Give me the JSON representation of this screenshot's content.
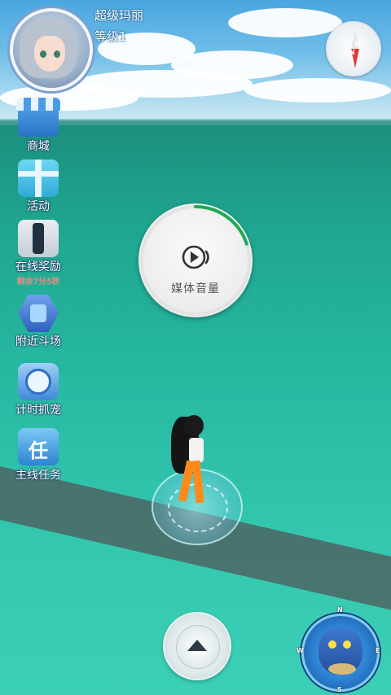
{
  "player": {
    "name": "超级玛丽",
    "level": "等级1"
  },
  "compass": {
    "north": "N",
    "south": "S"
  },
  "side_menu": {
    "items": [
      {
        "label": "商城",
        "icon": "shop-icon"
      },
      {
        "label": "活动",
        "icon": "gift-icon"
      },
      {
        "label": "在线奖励",
        "sublabel": "剩余7分5秒",
        "icon": "online-reward-icon"
      },
      {
        "label": "附近斗场",
        "icon": "arena-icon"
      },
      {
        "label": "计时抓宠",
        "icon": "timer-catch-icon"
      },
      {
        "label": "主线任务",
        "icon": "main-quest-icon",
        "glyph": "任"
      }
    ]
  },
  "media_volume": {
    "label": "媒体音量",
    "level": 0.2,
    "icon": "play-sound-icon",
    "accent": "#1faa54"
  },
  "controls": {
    "move_button_icon": "up-arrow-icon"
  },
  "pet_radar": {
    "N": "N",
    "E": "E",
    "S": "S",
    "W": "W"
  }
}
